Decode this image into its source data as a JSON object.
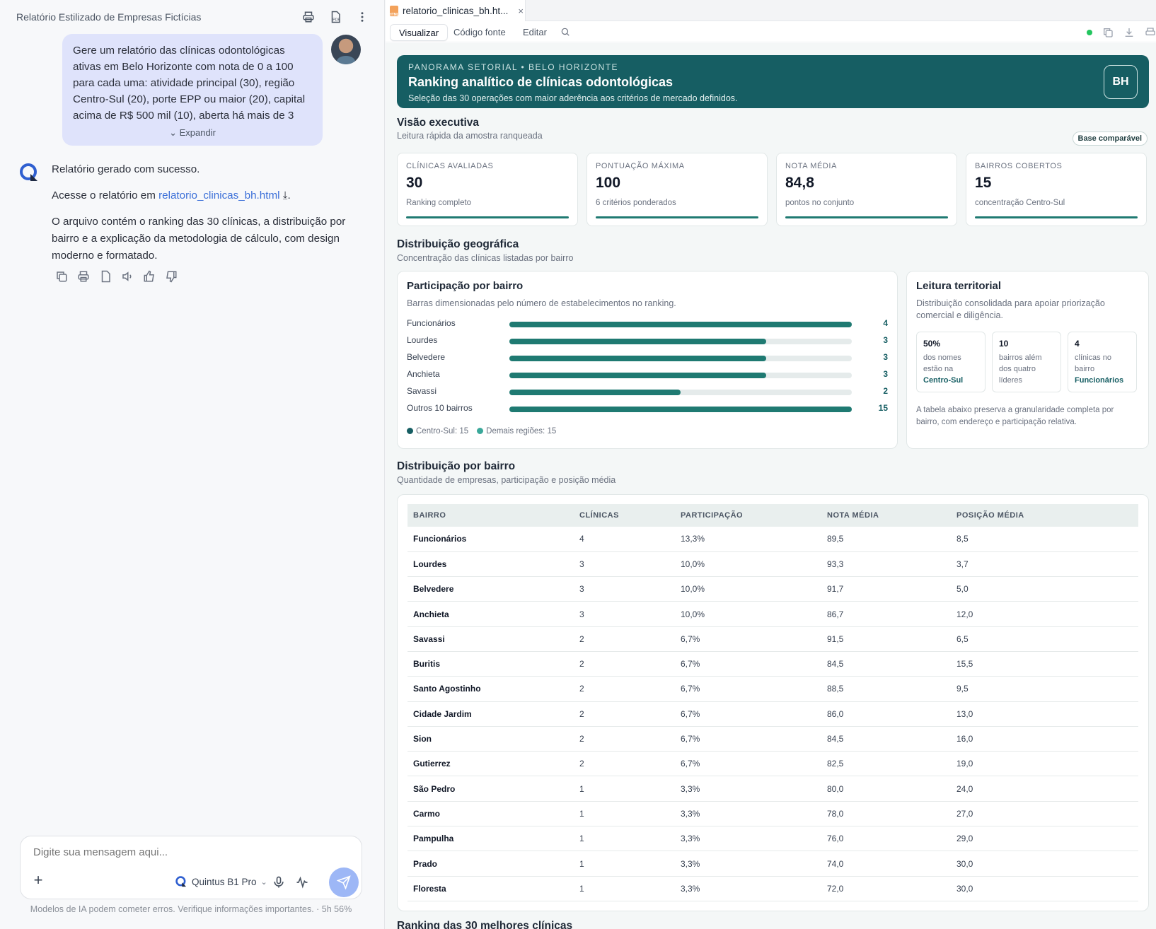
{
  "left": {
    "title": "Relatório Estilizado de Empresas Fictícias",
    "user_message": "Gere um relatório das clínicas odontológicas ativas em Belo Horizonte com nota de 0 a 100 para cada uma: atividade principal (30), região Centro-Sul (20), porte EPP ou maior (20), capital acima de R$ 500 mil (10), aberta há mais de 3",
    "expand_label": "Expandir",
    "bot": {
      "line1": "Relatório gerado com sucesso.",
      "line2_prefix": "Acesse o relatório em ",
      "link": "relatorio_clinicas_bh.html",
      "line2_suffix": ".",
      "line3": "O arquivo contém o ranking das 30 clínicas, a distribuição por bairro e a explicação da metodologia de cálculo, com design moderno e formatado."
    },
    "composer": {
      "placeholder": "Digite sua mensagem aqui...",
      "model": "Quintus B1 Pro"
    },
    "disclaimer": "Modelos de IA podem cometer erros. Verifique informações importantes. · 5h 56%"
  },
  "right": {
    "tab_name": "relatorio_clinicas_bh.ht...",
    "view_tabs": [
      "Visualizar",
      "Código fonte",
      "Editar"
    ],
    "hero": {
      "kicker": "PANORAMA SETORIAL • BELO HORIZONTE",
      "title": "Ranking analítico de clínicas odontológicas",
      "subtitle": "Seleção das 30 operações com maior aderência aos critérios de mercado definidos.",
      "badge": "BH"
    },
    "exec": {
      "title": "Visão executiva",
      "subtitle": "Leitura rápida da amostra ranqueada",
      "pill": "Base comparável",
      "kpis": [
        {
          "label": "CLÍNICAS AVALIADAS",
          "value": "30",
          "note": "Ranking completo"
        },
        {
          "label": "PONTUAÇÃO MÁXIMA",
          "value": "100",
          "note": "6 critérios ponderados"
        },
        {
          "label": "NOTA MÉDIA",
          "value": "84,8",
          "note": "pontos no conjunto"
        },
        {
          "label": "BAIRROS COBERTOS",
          "value": "15",
          "note": "concentração Centro-Sul"
        }
      ]
    },
    "geo": {
      "title": "Distribuição geográfica",
      "subtitle": "Concentração das clínicas listadas por bairro",
      "bars_card": {
        "title": "Participação por bairro",
        "subtitle": "Barras dimensionadas pelo número de estabelecimentos no ranking.",
        "rows": [
          {
            "label": "Funcionários",
            "value": "4",
            "fill": 1.0
          },
          {
            "label": "Lourdes",
            "value": "3",
            "fill": 0.75
          },
          {
            "label": "Belvedere",
            "value": "3",
            "fill": 0.75
          },
          {
            "label": "Anchieta",
            "value": "3",
            "fill": 0.75
          },
          {
            "label": "Savassi",
            "value": "2",
            "fill": 0.5
          },
          {
            "label": "Outros 10 bairros",
            "value": "15",
            "fill": 1.0
          }
        ],
        "legend": [
          {
            "label": "Centro-Sul: 15",
            "color": "#165e63"
          },
          {
            "label": "Demais regiões: 15",
            "color": "#3aa89a"
          }
        ]
      },
      "terr_card": {
        "title": "Leitura territorial",
        "subtitle": "Distribuição consolidada para apoiar priorização comercial e diligência.",
        "minis": [
          {
            "num": "50%",
            "text": "dos nomes estão na",
            "hl": "Centro-Sul"
          },
          {
            "num": "10",
            "text": "bairros além dos quatro líderes",
            "hl": ""
          },
          {
            "num": "4",
            "text": "clínicas no bairro",
            "hl": "Funcionários"
          }
        ],
        "note": "A tabela abaixo preserva a granularidade completa por bairro, com endereço e participação relativa."
      }
    },
    "dist": {
      "title": "Distribuição por bairro",
      "subtitle": "Quantidade de empresas, participação e posição média",
      "headers": [
        "BAIRRO",
        "CLÍNICAS",
        "PARTICIPAÇÃO",
        "NOTA MÉDIA",
        "POSIÇÃO MÉDIA"
      ],
      "rows": [
        [
          "Funcionários",
          "4",
          "13,3%",
          "89,5",
          "8,5"
        ],
        [
          "Lourdes",
          "3",
          "10,0%",
          "93,3",
          "3,7"
        ],
        [
          "Belvedere",
          "3",
          "10,0%",
          "91,7",
          "5,0"
        ],
        [
          "Anchieta",
          "3",
          "10,0%",
          "86,7",
          "12,0"
        ],
        [
          "Savassi",
          "2",
          "6,7%",
          "91,5",
          "6,5"
        ],
        [
          "Buritis",
          "2",
          "6,7%",
          "84,5",
          "15,5"
        ],
        [
          "Santo Agostinho",
          "2",
          "6,7%",
          "88,5",
          "9,5"
        ],
        [
          "Cidade Jardim",
          "2",
          "6,7%",
          "86,0",
          "13,0"
        ],
        [
          "Sion",
          "2",
          "6,7%",
          "84,5",
          "16,0"
        ],
        [
          "Gutierrez",
          "2",
          "6,7%",
          "82,5",
          "19,0"
        ],
        [
          "São Pedro",
          "1",
          "3,3%",
          "80,0",
          "24,0"
        ],
        [
          "Carmo",
          "1",
          "3,3%",
          "78,0",
          "27,0"
        ],
        [
          "Pampulha",
          "1",
          "3,3%",
          "76,0",
          "29,0"
        ],
        [
          "Prado",
          "1",
          "3,3%",
          "74,0",
          "30,0"
        ],
        [
          "Floresta",
          "1",
          "3,3%",
          "72,0",
          "30,0"
        ]
      ]
    },
    "next_section": "Ranking das 30 melhores clínicas"
  }
}
